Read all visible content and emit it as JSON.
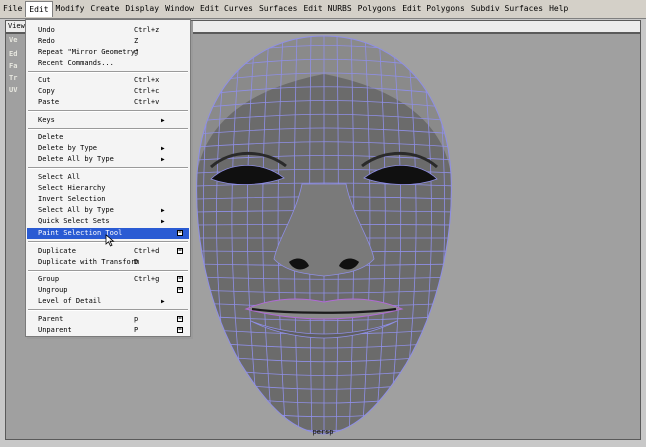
{
  "menubar": {
    "items": [
      "File",
      "Edit",
      "Modify",
      "Create",
      "Display",
      "Window",
      "Edit Curves",
      "Surfaces",
      "Edit NURBS",
      "Polygons",
      "Edit Polygons",
      "Subdiv Surfaces",
      "Help"
    ]
  },
  "panel": {
    "menu_label": "View",
    "side_labels": [
      "Ve",
      "Ed",
      "Fa",
      "Tr",
      "UV"
    ],
    "camera_label": "persp"
  },
  "edit_menu": {
    "items": [
      {
        "label": "Undo",
        "shortcut": "Ctrl+z"
      },
      {
        "label": "Redo",
        "shortcut": "Z"
      },
      {
        "label": "Repeat \"Mirror Geometry\"",
        "shortcut": "g"
      },
      {
        "label": "Recent Commands..."
      },
      {
        "label": "Cut",
        "shortcut": "Ctrl+x"
      },
      {
        "label": "Copy",
        "shortcut": "Ctrl+c"
      },
      {
        "label": "Paste",
        "shortcut": "Ctrl+v"
      },
      {
        "label": "Keys",
        "submenu": true
      },
      {
        "label": "Delete"
      },
      {
        "label": "Delete by Type",
        "submenu": true
      },
      {
        "label": "Delete All by Type",
        "submenu": true
      },
      {
        "label": "Select All"
      },
      {
        "label": "Select Hierarchy"
      },
      {
        "label": "Invert Selection"
      },
      {
        "label": "Select All by Type",
        "submenu": true
      },
      {
        "label": "Quick Select Sets",
        "submenu": true
      },
      {
        "label": "Paint Selection Tool",
        "option_box": true,
        "highlighted": true
      },
      {
        "label": "Duplicate",
        "shortcut": "Ctrl+d",
        "option_box": true
      },
      {
        "label": "Duplicate with Transform",
        "shortcut": "D"
      },
      {
        "label": "Group",
        "shortcut": "Ctrl+g",
        "option_box": true
      },
      {
        "label": "Ungroup",
        "option_box": true
      },
      {
        "label": "Level of Detail",
        "submenu": true
      },
      {
        "label": "Parent",
        "shortcut": "p",
        "option_box": true
      },
      {
        "label": "Unparent",
        "shortcut": "P",
        "option_box": true
      }
    ]
  },
  "colors": {
    "menu_bg": "#d4d0c8",
    "viewport_bg": "#a0a0a0",
    "highlight": "#2a5bd3",
    "wire": "#8f8fe6",
    "mesh": "#6b6b6b"
  },
  "icons": [
    "submenu-arrow-icon",
    "option-box-icon",
    "mouse-cursor-icon",
    "view-axis-icon"
  ]
}
